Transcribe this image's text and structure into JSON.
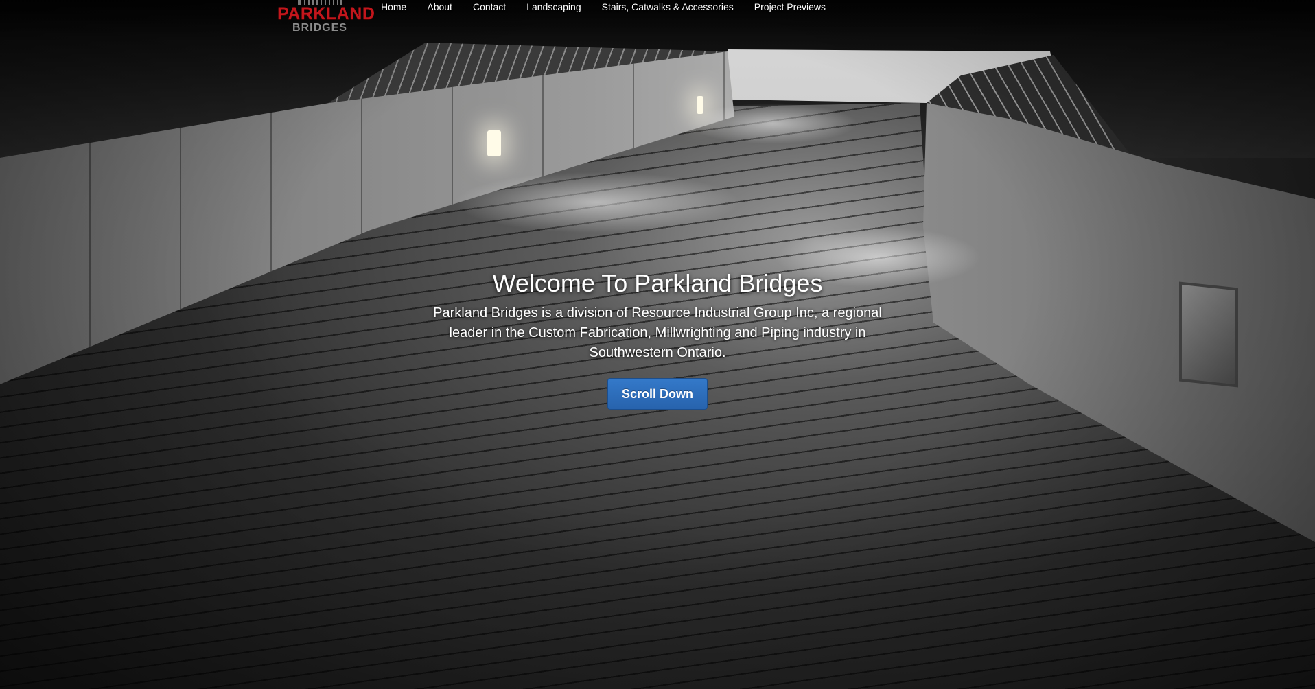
{
  "brand": {
    "logo_main": "PARKLAND",
    "logo_sub": "BRIDGES",
    "logo_color": "#c3161c"
  },
  "nav": {
    "items": [
      {
        "label": "Home"
      },
      {
        "label": "About"
      },
      {
        "label": "Contact"
      },
      {
        "label": "Landscaping"
      },
      {
        "label": "Stairs, Catwalks & Accessories"
      },
      {
        "label": "Project Previews"
      }
    ]
  },
  "hero": {
    "title": "Welcome To Parkland Bridges",
    "text": "Parkland Bridges is a division of Resource Industrial Group Inc, a regional leader in the Custom Fabrication, Millwrighting and Piping industry in Southwestern Ontario.",
    "button_label": "Scroll Down",
    "button_color": "#2d6ebd"
  },
  "background": {
    "description_icon": "bridge-walkway-photo"
  }
}
